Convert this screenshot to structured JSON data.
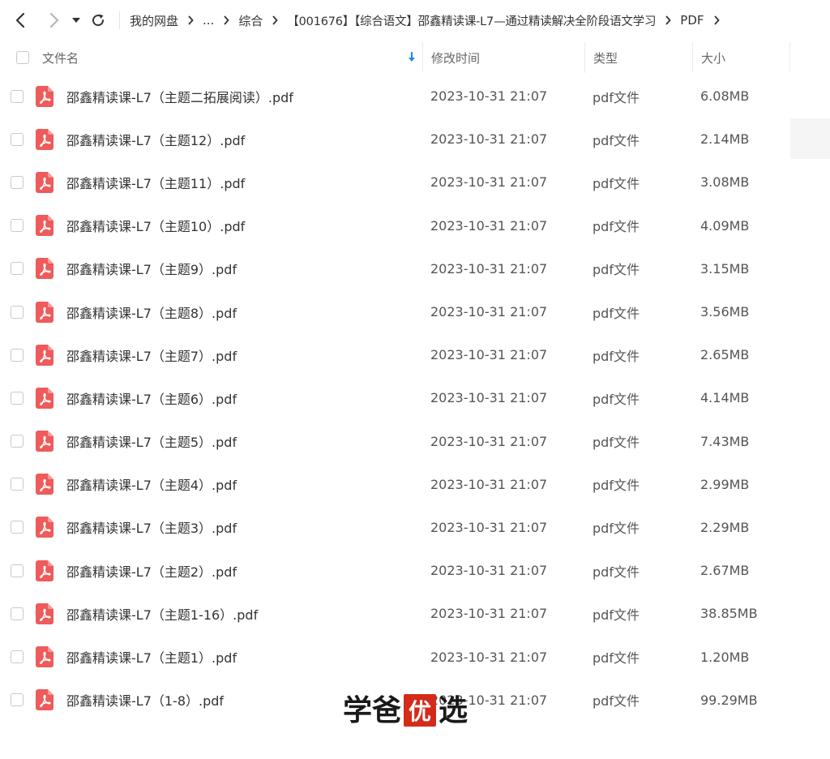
{
  "nav": {
    "back_icon": "chevron-left-icon",
    "forward_icon": "chevron-right-icon",
    "history_icon": "caret-down-icon",
    "refresh_icon": "refresh-icon",
    "breadcrumbs": [
      "我的网盘",
      "...",
      "综合",
      "【001676】【综合语文】邵鑫精读课-L7—通过精读解决全阶段语文学习",
      "PDF"
    ]
  },
  "header": {
    "name": "文件名",
    "time": "修改时间",
    "type": "类型",
    "size": "大小",
    "sort_icon": "arrow-down-icon"
  },
  "files": [
    {
      "name": "邵鑫精读课-L7（主题二拓展阅读）.pdf",
      "time": "2023-10-31 21:07",
      "type": "pdf文件",
      "size": "6.08MB"
    },
    {
      "name": "邵鑫精读课-L7（主题12）.pdf",
      "time": "2023-10-31 21:07",
      "type": "pdf文件",
      "size": "2.14MB"
    },
    {
      "name": "邵鑫精读课-L7（主题11）.pdf",
      "time": "2023-10-31 21:07",
      "type": "pdf文件",
      "size": "3.08MB"
    },
    {
      "name": "邵鑫精读课-L7（主题10）.pdf",
      "time": "2023-10-31 21:07",
      "type": "pdf文件",
      "size": "4.09MB"
    },
    {
      "name": "邵鑫精读课-L7（主题9）.pdf",
      "time": "2023-10-31 21:07",
      "type": "pdf文件",
      "size": "3.15MB"
    },
    {
      "name": "邵鑫精读课-L7（主题8）.pdf",
      "time": "2023-10-31 21:07",
      "type": "pdf文件",
      "size": "3.56MB"
    },
    {
      "name": "邵鑫精读课-L7（主题7）.pdf",
      "time": "2023-10-31 21:07",
      "type": "pdf文件",
      "size": "2.65MB"
    },
    {
      "name": "邵鑫精读课-L7（主题6）.pdf",
      "time": "2023-10-31 21:07",
      "type": "pdf文件",
      "size": "4.14MB"
    },
    {
      "name": "邵鑫精读课-L7（主题5）.pdf",
      "time": "2023-10-31 21:07",
      "type": "pdf文件",
      "size": "7.43MB"
    },
    {
      "name": "邵鑫精读课-L7（主题4）.pdf",
      "time": "2023-10-31 21:07",
      "type": "pdf文件",
      "size": "2.99MB"
    },
    {
      "name": "邵鑫精读课-L7（主题3）.pdf",
      "time": "2023-10-31 21:07",
      "type": "pdf文件",
      "size": "2.29MB"
    },
    {
      "name": "邵鑫精读课-L7（主题2）.pdf",
      "time": "2023-10-31 21:07",
      "type": "pdf文件",
      "size": "2.67MB"
    },
    {
      "name": "邵鑫精读课-L7（主题1-16）.pdf",
      "time": "2023-10-31 21:07",
      "type": "pdf文件",
      "size": "38.85MB"
    },
    {
      "name": "邵鑫精读课-L7（主题1）.pdf",
      "time": "2023-10-31 21:07",
      "type": "pdf文件",
      "size": "1.20MB"
    },
    {
      "name": "邵鑫精读课-L7（1-8）.pdf",
      "time": "2023-10-31 21:07",
      "type": "pdf文件",
      "size": "99.29MB"
    }
  ],
  "file_icon": "pdf-file-icon",
  "watermark": {
    "chars": [
      "学",
      "爸",
      "优",
      "选"
    ]
  },
  "colors": {
    "pdf_icon": "#ef5a5a",
    "sort_arrow": "#1e88e5",
    "watermark_stamp": "#d42a1a"
  }
}
